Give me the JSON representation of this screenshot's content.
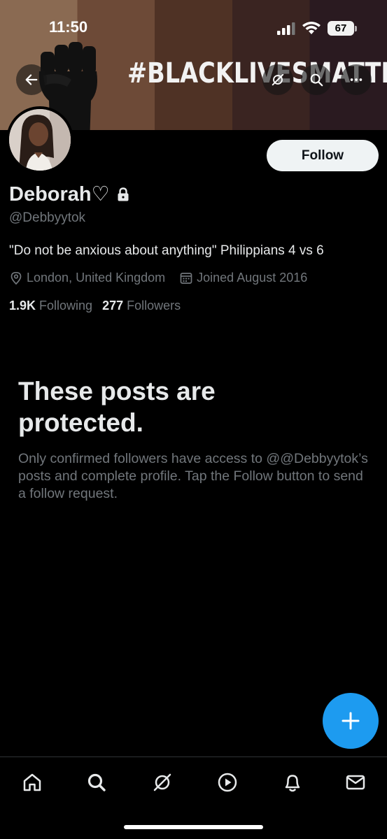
{
  "status_bar": {
    "time": "11:50",
    "battery": "67"
  },
  "banner": {
    "text": "#BLACKLIVESMATTER"
  },
  "profile": {
    "display_name": "Deborah♡",
    "handle": "@Debbyytok",
    "bio": "\"Do not be anxious about anything\" Philippians 4 vs 6",
    "location": "London, United Kingdom",
    "joined": "Joined August 2016",
    "following_count": "1.9K",
    "following_label": "Following",
    "followers_count": "277",
    "followers_label": "Followers",
    "follow_button_label": "Follow"
  },
  "protected": {
    "title": "These posts are protected.",
    "body": "Only confirmed followers have access to @@Debbyytok’s posts and complete profile. Tap the Follow button to send a follow request."
  },
  "icons": {
    "back": "arrow-left-icon",
    "grok": "grok-icon",
    "search": "search-icon",
    "more": "more-icon",
    "lock": "lock-icon",
    "location": "location-pin-icon",
    "calendar": "calendar-icon",
    "compose": "plus-icon",
    "nav": [
      "home-icon",
      "search-icon",
      "grok-icon",
      "video-play-icon",
      "bell-icon",
      "mail-icon"
    ]
  },
  "colors": {
    "accent": "#1d9bf0",
    "background": "#000000",
    "secondary_text": "#71767b",
    "primary_text": "#e7e9ea"
  }
}
